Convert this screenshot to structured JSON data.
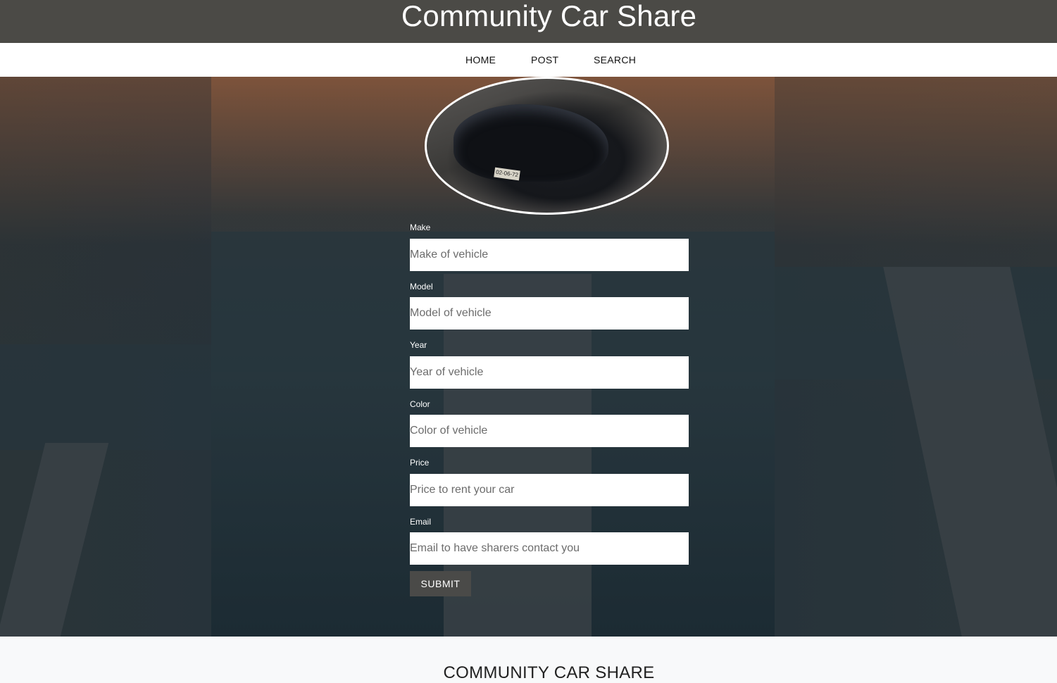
{
  "header": {
    "title": "Community Car Share"
  },
  "nav": {
    "home": "HOME",
    "post": "POST",
    "search": "SEARCH"
  },
  "form": {
    "make": {
      "label": "Make",
      "placeholder": "Make of vehicle",
      "value": ""
    },
    "model": {
      "label": "Model",
      "placeholder": "Model of vehicle",
      "value": ""
    },
    "year": {
      "label": "Year",
      "placeholder": "Year of vehicle",
      "value": ""
    },
    "color": {
      "label": "Color",
      "placeholder": "Color of vehicle",
      "value": ""
    },
    "price": {
      "label": "Price",
      "placeholder": "Price to rent your car",
      "value": ""
    },
    "email": {
      "label": "Email",
      "placeholder": "Email to have sharers contact you",
      "value": ""
    },
    "submit_label": "SUBMIT"
  },
  "car_image": {
    "plate": "02-06-72"
  },
  "footer": {
    "title": "COMMUNITY CAR SHARE"
  },
  "colors": {
    "header_bg": "#4b4a46",
    "button_bg": "#4a4a48",
    "footer_bg": "#f8f9fa"
  }
}
